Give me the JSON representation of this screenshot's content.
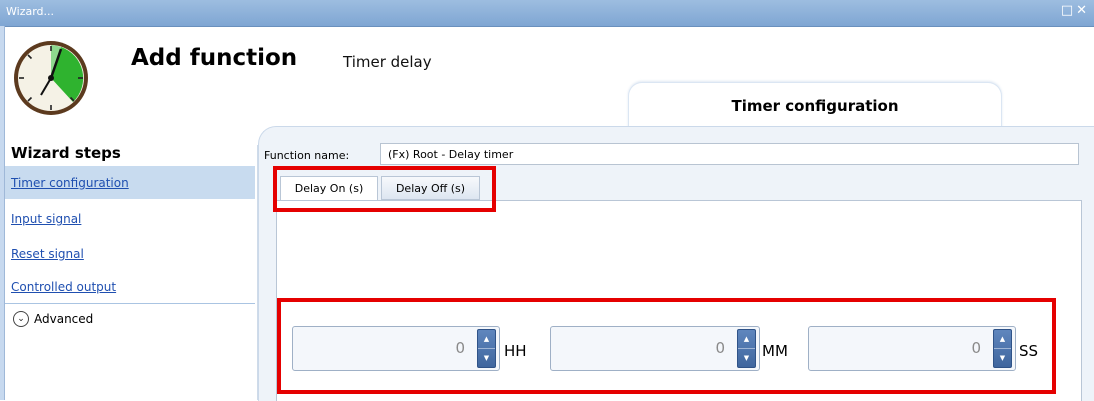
{
  "window": {
    "title": "Wizard...",
    "controls": "□✕"
  },
  "header": {
    "title": "Add function",
    "subtitle": "Timer delay",
    "tab_label": "Timer configuration"
  },
  "sidebar": {
    "title": "Wizard steps",
    "items": [
      {
        "label": "Timer configuration",
        "active": true
      },
      {
        "label": "Input signal",
        "active": false
      },
      {
        "label": "Reset signal",
        "active": false
      },
      {
        "label": "Controlled output",
        "active": false
      }
    ],
    "advanced_label": "Advanced",
    "advanced_icon": "chevron-down-circle-icon"
  },
  "form": {
    "function_name_label": "Function name:",
    "function_name_value": "(Fx) Root - Delay timer",
    "tabs": [
      {
        "label": "Delay On (s)",
        "selected": true
      },
      {
        "label": "Delay Off (s)",
        "selected": false
      }
    ],
    "fields": [
      {
        "value": "0",
        "unit": "HH"
      },
      {
        "value": "0",
        "unit": "MM"
      },
      {
        "value": "0",
        "unit": "SS"
      }
    ]
  },
  "colors": {
    "highlight": "#e50000",
    "link": "#1f4fb0",
    "active_item_bg": "#c8dbef",
    "spinner_button": "#4a72aa"
  }
}
